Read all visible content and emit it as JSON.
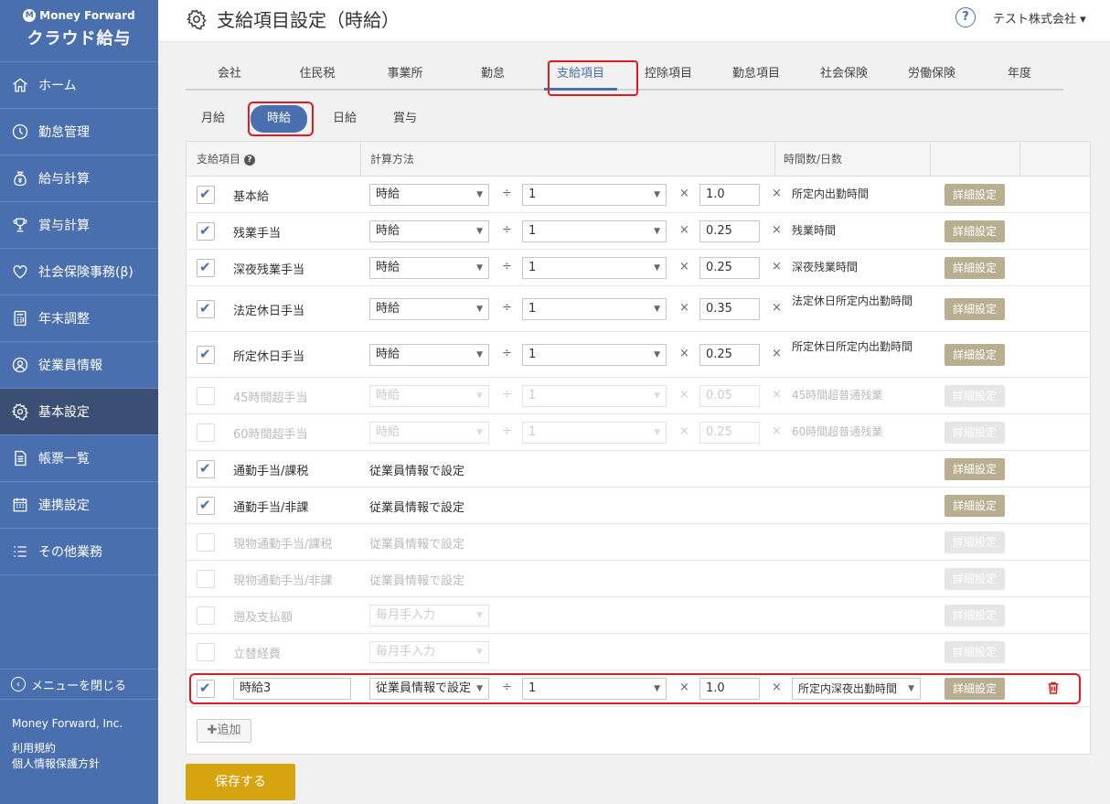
{
  "brand": {
    "top": "Money Forward",
    "bottom": "クラウド給与",
    "logo_glyph": "M"
  },
  "sidebar": {
    "items": [
      {
        "label": "ホーム",
        "icon": "home-icon"
      },
      {
        "label": "勤怠管理",
        "icon": "clock-icon"
      },
      {
        "label": "給与計算",
        "icon": "money-bag-icon"
      },
      {
        "label": "賞与計算",
        "icon": "trophy-icon"
      },
      {
        "label": "社会保険事務(β)",
        "icon": "heart-icon"
      },
      {
        "label": "年末調整",
        "icon": "calculator-icon"
      },
      {
        "label": "従業員情報",
        "icon": "person-icon"
      },
      {
        "label": "基本設定",
        "icon": "gear-icon",
        "active": true
      },
      {
        "label": "帳票一覧",
        "icon": "document-icon"
      },
      {
        "label": "連携設定",
        "icon": "calendar-icon"
      },
      {
        "label": "その他業務",
        "icon": "list-icon"
      }
    ],
    "collapse_label": "メニューを閉じる",
    "company": "Money Forward, Inc.",
    "links": [
      "利用規約",
      "個人情報保護方針"
    ]
  },
  "header": {
    "title": "支給項目設定（時給）",
    "help": "?",
    "company_menu": "テスト株式会社 ▾"
  },
  "tabs": [
    "会社",
    "住民税",
    "事業所",
    "勤怠",
    "支給項目",
    "控除項目",
    "勤怠項目",
    "社会保険",
    "労働保険",
    "年度"
  ],
  "active_tab": 4,
  "subtabs": [
    "月給",
    "時給",
    "日給",
    "賞与"
  ],
  "active_subtab": 1,
  "table": {
    "headers": {
      "item": "支給項目",
      "help": "?",
      "method": "計算方法",
      "hours": "時間数/日数"
    },
    "rows": [
      {
        "checked": true,
        "disabled": false,
        "name": "基本給",
        "type": "calc",
        "method": "時給",
        "divisor": "1",
        "multiplier": "1.0",
        "target": "所定内出勤時間",
        "detail": "詳細設定"
      },
      {
        "checked": true,
        "disabled": false,
        "name": "残業手当",
        "type": "calc",
        "method": "時給",
        "divisor": "1",
        "multiplier": "0.25",
        "target": "残業時間",
        "detail": "詳細設定"
      },
      {
        "checked": true,
        "disabled": false,
        "name": "深夜残業手当",
        "type": "calc",
        "method": "時給",
        "divisor": "1",
        "multiplier": "0.25",
        "target": "深夜残業時間",
        "detail": "詳細設定"
      },
      {
        "checked": true,
        "disabled": false,
        "name": "法定休日手当",
        "type": "calc",
        "method": "時給",
        "divisor": "1",
        "multiplier": "0.35",
        "target": "法定休日所定内出勤時間",
        "detail": "詳細設定"
      },
      {
        "checked": true,
        "disabled": false,
        "name": "所定休日手当",
        "type": "calc",
        "method": "時給",
        "divisor": "1",
        "multiplier": "0.25",
        "target": "所定休日所定内出勤時間",
        "detail": "詳細設定"
      },
      {
        "checked": false,
        "disabled": true,
        "name": "45時間超手当",
        "type": "calc",
        "method": "時給",
        "divisor": "1",
        "multiplier": "0.05",
        "target": "45時間超普通残業",
        "detail": "詳細設定"
      },
      {
        "checked": false,
        "disabled": true,
        "name": "60時間超手当",
        "type": "calc",
        "method": "時給",
        "divisor": "1",
        "multiplier": "0.25",
        "target": "60時間超普通残業",
        "detail": "詳細設定"
      },
      {
        "checked": true,
        "disabled": false,
        "name": "通勤手当/課税",
        "type": "plain",
        "text": "従業員情報で設定",
        "detail": "詳細設定"
      },
      {
        "checked": true,
        "disabled": false,
        "name": "通勤手当/非課",
        "type": "plain",
        "text": "従業員情報で設定",
        "detail": "詳細設定"
      },
      {
        "checked": false,
        "disabled": true,
        "name": "現物通勤手当/課税",
        "type": "plain",
        "text": "従業員情報で設定",
        "detail": "詳細設定"
      },
      {
        "checked": false,
        "disabled": true,
        "name": "現物通勤手当/非課",
        "type": "plain",
        "text": "従業員情報で設定",
        "detail": "詳細設定"
      },
      {
        "checked": false,
        "disabled": true,
        "name": "遡及支払額",
        "type": "select",
        "method": "毎月手入力",
        "detail": "詳細設定"
      },
      {
        "checked": false,
        "disabled": true,
        "name": "立替経費",
        "type": "select",
        "method": "毎月手入力",
        "detail": "詳細設定"
      },
      {
        "checked": true,
        "disabled": false,
        "name": "時給3",
        "type": "custom",
        "method": "従業員情報で設定",
        "divisor": "1",
        "multiplier": "1.0",
        "target": "所定内深夜出勤時間",
        "detail": "詳細設定"
      }
    ],
    "add_label": "✚追加",
    "divide_symbol": "÷",
    "times_symbol": "×",
    "arrow_symbol": "▼"
  },
  "save_label": "保存する",
  "colors": {
    "brand": "#4a6fae",
    "detail_button": "#b9ae8f",
    "save_button": "#d5a40f",
    "highlight": "#e01b24"
  }
}
